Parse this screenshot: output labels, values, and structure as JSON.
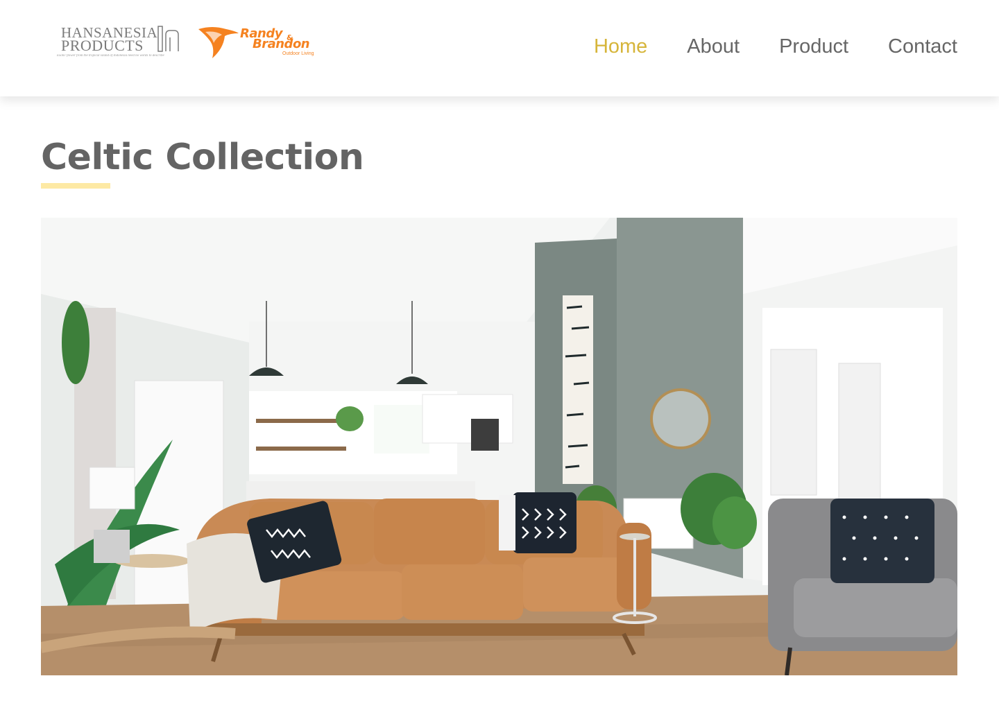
{
  "header": {
    "logos": [
      {
        "name": "Hansanesia Products",
        "lines": [
          "HANSANESIA",
          "PRODUCTS"
        ],
        "tagline": "Exotic flower from the tropical island of Indonesia need no words to describe"
      },
      {
        "name": "Randy & Brandon Outdoor Living",
        "line1": "Randy",
        "amp": "&",
        "line2": "Brandon",
        "subline": "Outdoor Living"
      }
    ],
    "nav": [
      {
        "label": "Home",
        "active": true
      },
      {
        "label": "About",
        "active": false
      },
      {
        "label": "Product",
        "active": false
      },
      {
        "label": "Contact",
        "active": false
      }
    ]
  },
  "main": {
    "title": "Celtic Collection"
  },
  "colors": {
    "nav_active": "#d6b53a",
    "nav_default": "#666666",
    "title": "#646464",
    "title_underline": "#fde9a4",
    "randy_brand": "#f58220"
  }
}
